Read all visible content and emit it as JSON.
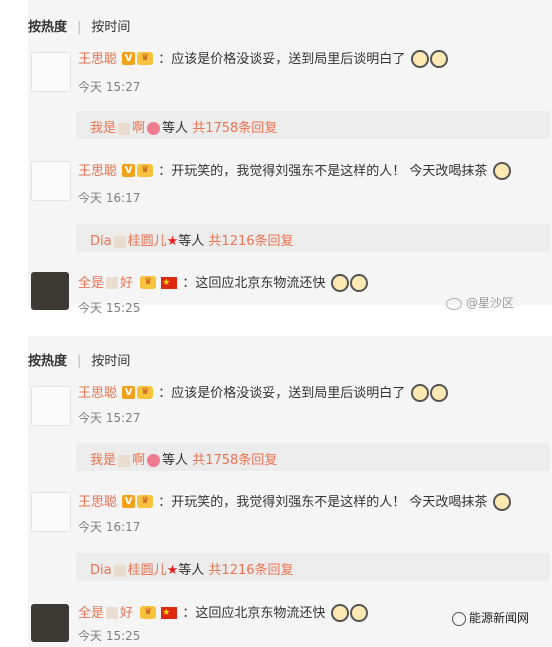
{
  "sort_tabs": {
    "hot": "按热度",
    "time": "按时间"
  },
  "comments": [
    {
      "username": "王思聪",
      "text": "：应该是价格没谈妥，送到局里后谈明白了",
      "time": "今天 15:27",
      "reply_summary": {
        "prefix": "我是",
        "middle": "啊",
        "suffix": "等人",
        "count": "共1758条回复"
      }
    },
    {
      "username": "王思聪",
      "text": "：开玩笑的，我觉得刘强东不是这样的人！ 今天改喝抹茶",
      "time": "今天 16:17",
      "reply_summary": {
        "prefix": "Dia",
        "middle": "桂圆儿",
        "suffix": "等人",
        "count": "共1216条回复"
      }
    },
    {
      "username": "全是",
      "username_tail": "好",
      "text": "：这回应北京东物流还快",
      "time": "今天 15:25"
    }
  ],
  "watermark": "@星沙区",
  "brand": "能源新闻网",
  "colors": {
    "username": "#eb7350",
    "verified": "#f2a11a",
    "panel": "#f5f5f5"
  }
}
